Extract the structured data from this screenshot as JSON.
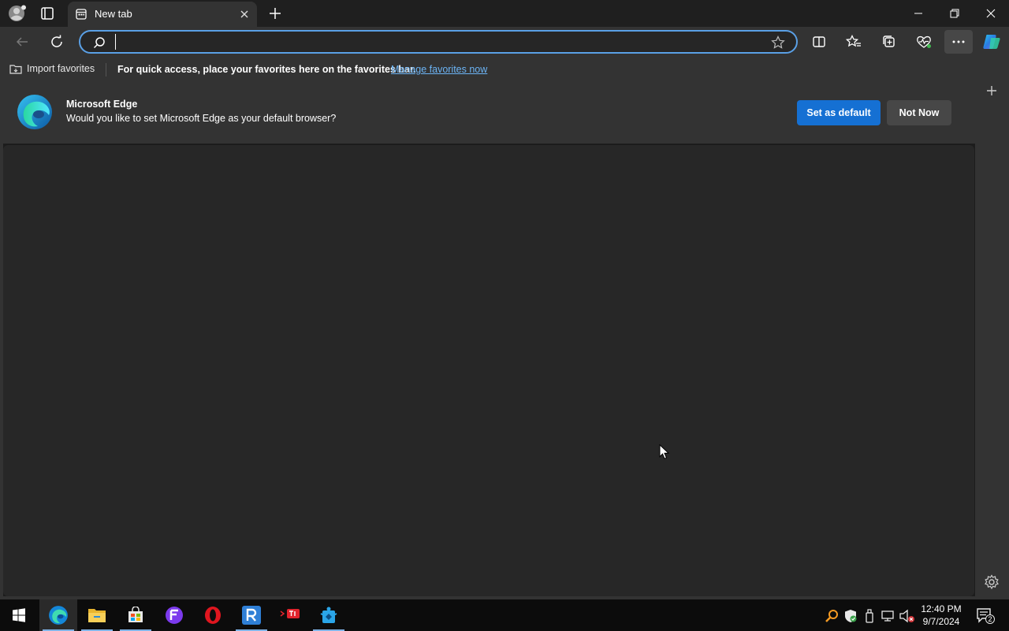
{
  "tab": {
    "title": "New tab"
  },
  "address_bar": {
    "value": "",
    "placeholder": ""
  },
  "favorites_bar": {
    "import_label": "Import favorites",
    "message": "For quick access, place your favorites here on the favorites bar.",
    "manage_link": "Manage favorites now"
  },
  "infobar": {
    "title": "Microsoft Edge",
    "message": "Would you like to set Microsoft Edge as your default browser?",
    "primary_button": "Set as default",
    "secondary_button": "Not Now"
  },
  "taskbar": {
    "apps": [
      "edge-icon",
      "file-explorer-icon",
      "store-icon",
      "app-f-icon",
      "opera-icon",
      "app-r-icon",
      "app-ti-icon",
      "app-blue-icon"
    ],
    "notification_count": "2"
  },
  "clock": {
    "time": "12:40 PM",
    "date": "9/7/2024"
  },
  "colors": {
    "accent": "#1570d3",
    "link": "#6cb4f5",
    "focus_ring": "#5aa0e6"
  }
}
